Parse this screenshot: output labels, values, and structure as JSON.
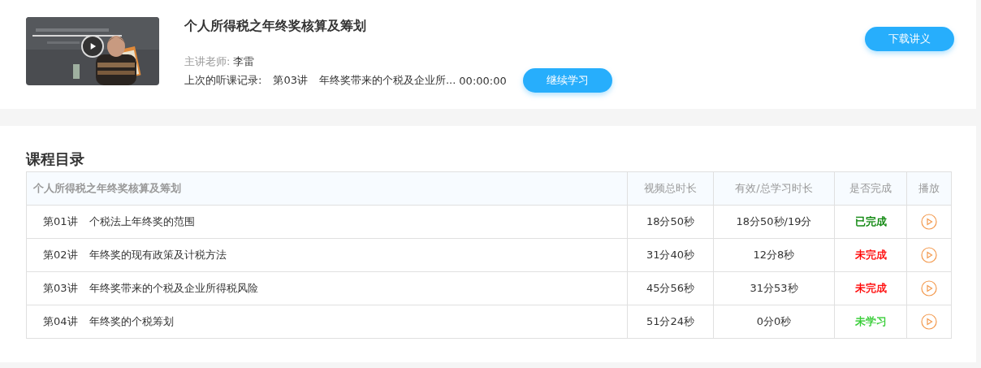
{
  "course": {
    "title": "个人所得税之年终奖核算及筹划",
    "teacher_label": "主讲老师:",
    "teacher": "李雷",
    "last_record_label": "上次的听课记录:",
    "last_record_lesson": "第03讲",
    "last_record_title": "年终奖带来的个税及企业所...",
    "last_record_time": "00:00:00",
    "continue_button": "继续学习",
    "download_button": "下载讲义"
  },
  "catalog": {
    "heading": "课程目录",
    "columns": [
      "个人所得税之年终奖核算及筹划",
      "视频总时长",
      "有效/总学习时长",
      "是否完成",
      "播放"
    ],
    "rows": [
      {
        "lesson": "第01讲",
        "title": "个税法上年终奖的范围",
        "duration": "18分50秒",
        "studied": "18分50秒/19分",
        "status": "已完成",
        "color": "#008000"
      },
      {
        "lesson": "第02讲",
        "title": "年终奖的现有政策及计税方法",
        "duration": "31分40秒",
        "studied": "12分8秒",
        "status": "未完成",
        "color": "#ff0000"
      },
      {
        "lesson": "第03讲",
        "title": "年终奖带来的个税及企业所得税风险",
        "duration": "45分56秒",
        "studied": "31分53秒",
        "status": "未完成",
        "color": "#ff0000"
      },
      {
        "lesson": "第04讲",
        "title": "年终奖的个税筹划",
        "duration": "51分24秒",
        "studied": "0分0秒",
        "status": "未学习",
        "color": "#33cc33"
      }
    ]
  }
}
